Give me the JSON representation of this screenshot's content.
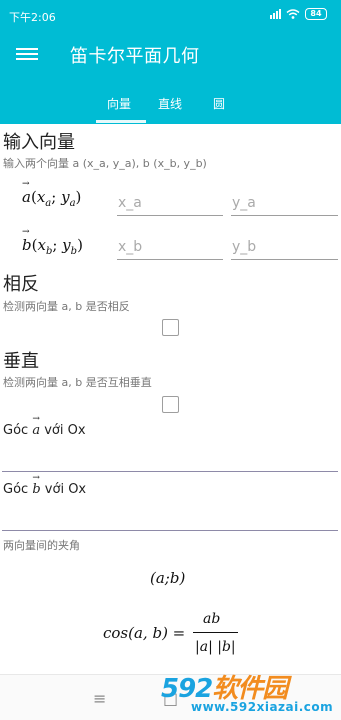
{
  "status_bar": {
    "time": "下午2:06",
    "battery": "84"
  },
  "app_bar": {
    "title": "笛卡尔平面几何",
    "menu_icon": "menu-icon"
  },
  "tabs": [
    {
      "label": "向量",
      "active": true
    },
    {
      "label": "直线",
      "active": false
    },
    {
      "label": "圆",
      "active": false
    }
  ],
  "vector_input": {
    "title": "输入向量",
    "description": "输入两个向量 a (x_a, y_a), b (x_b, y_b)",
    "vector_a": {
      "name": "a",
      "x_sub": "a",
      "y_sub": "a",
      "x_placeholder": "x_a",
      "y_placeholder": "y_a"
    },
    "vector_b": {
      "name": "b",
      "x_sub": "b",
      "y_sub": "b",
      "x_placeholder": "x_b",
      "y_placeholder": "y_b"
    }
  },
  "opposite": {
    "title": "相反",
    "description": "检测两向量 a, b 是否相反",
    "checked": false
  },
  "perpendicular": {
    "title": "垂直",
    "description": "检测两向量 a, b 是否互相垂直",
    "checked": false
  },
  "angle_a": {
    "prefix": "Góc",
    "vector": "a",
    "suffix": "với Ox",
    "value": ""
  },
  "angle_b": {
    "prefix": "Góc",
    "vector": "b",
    "suffix": "với Ox",
    "value": ""
  },
  "angle_between": {
    "title": "两向量间的夹角",
    "formula_angle": "(a;b)",
    "formula_cos_lhs": "cos(a, b) =",
    "numerator": "ab",
    "denominator": "|a| |b|"
  },
  "watermark": {
    "main_prefix": "592",
    "main_suffix": "软件园",
    "sub": "www.592xiazai.com"
  },
  "colors": {
    "primary": "#00BCD4",
    "divider": "#9e9e9e",
    "result_line": "#8e8aa8"
  }
}
